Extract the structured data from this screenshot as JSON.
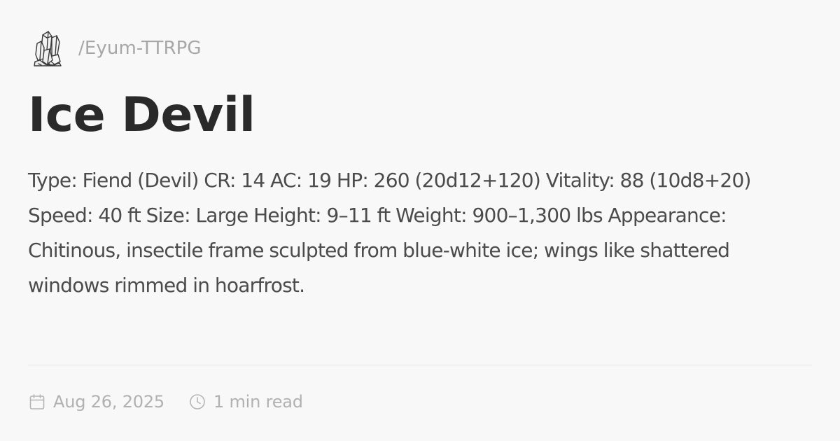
{
  "site": {
    "logo_icon": "crystal-icon",
    "path": "/Eyum-TTRPG"
  },
  "article": {
    "title": "Ice Devil",
    "description": "Type: Fiend (Devil) CR: 14 AC: 19 HP: 260 (20d12+120) Vitality: 88 (10d8+20) Speed: 40 ft Size: Large Height: 9–11 ft Weight: 900–1,300 lbs Appearance: Chitinous, insectile frame sculpted from blue-white ice; wings like shattered windows rimmed in hoarfrost."
  },
  "meta": {
    "date_icon": "calendar-icon",
    "date": "Aug 26, 2025",
    "read_time_icon": "clock-icon",
    "read_time": "1 min read"
  },
  "colors": {
    "background": "#f9f8f9",
    "title": "#2a2a2a",
    "body_text": "#4b4b4b",
    "muted_text": "#a7a7a7",
    "divider": "#e7e5e7"
  }
}
